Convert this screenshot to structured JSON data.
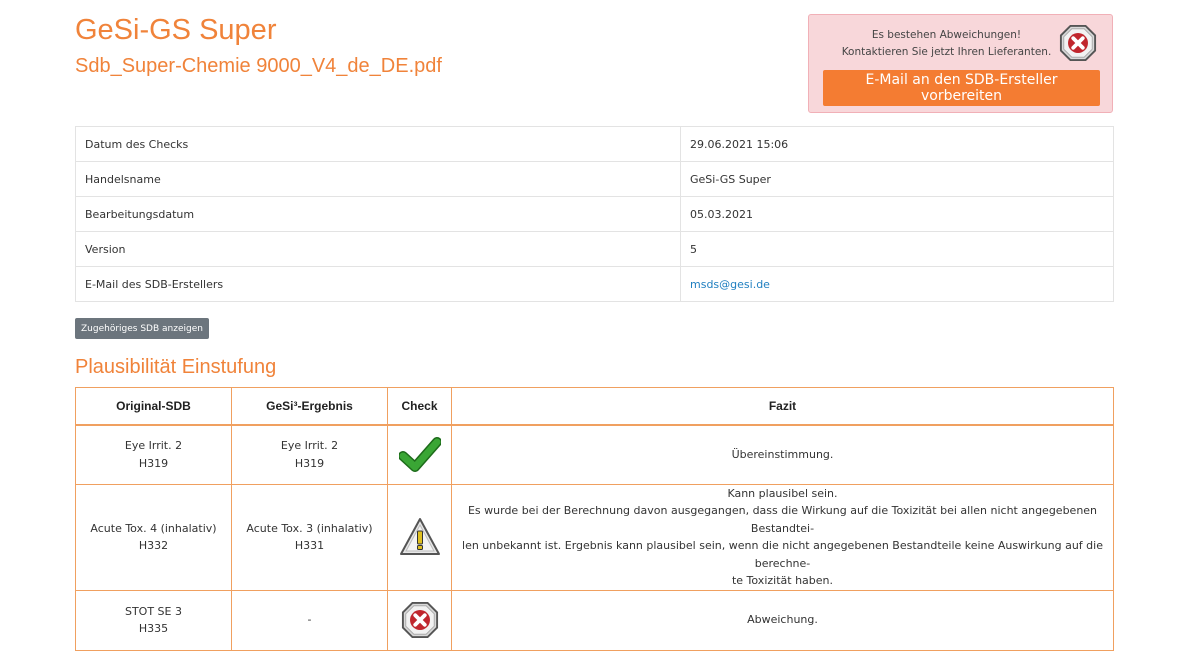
{
  "header": {
    "title": "GeSi-GS Super",
    "filename": "Sdb_Super-Chemie 9000_V4_de_DE.pdf"
  },
  "alert": {
    "line1": "Es bestehen Abweichungen!",
    "line2": "Kontaktieren Sie jetzt Ihren Lieferanten.",
    "button_label": "E-Mail an den SDB-Ersteller vorbereiten",
    "icon": "error-x-icon"
  },
  "info": {
    "rows": [
      {
        "label": "Datum des Checks",
        "value": "29.06.2021 15:06"
      },
      {
        "label": "Handelsname",
        "value": "GeSi-GS Super"
      },
      {
        "label": "Bearbeitungsdatum",
        "value": "05.03.2021"
      },
      {
        "label": "Version",
        "value": "5"
      },
      {
        "label": "E-Mail des SDB-Erstellers",
        "value": "msds@gesi.de"
      }
    ]
  },
  "sdb_button_label": "Zugehöriges SDB anzeigen",
  "plausibility": {
    "title": "Plausibilität Einstufung",
    "headers": {
      "original": "Original-SDB",
      "gesi": "GeSi³-Ergebnis",
      "check": "Check",
      "fazit": "Fazit"
    },
    "rows": [
      {
        "original": [
          "Eye Irrit. 2",
          "H319"
        ],
        "gesi": [
          "Eye Irrit. 2",
          "H319"
        ],
        "check_icon": "checkmark-icon",
        "fazit": [
          "Übereinstimmung."
        ]
      },
      {
        "original": [
          "Acute Tox. 4 (inhalativ)",
          "H332"
        ],
        "gesi": [
          "Acute Tox. 3 (inhalativ)",
          "H331"
        ],
        "check_icon": "warning-icon",
        "fazit": [
          "Kann plausibel sein.",
          "Es wurde bei der Berechnung davon ausgegangen, dass die Wirkung auf die Toxizität bei allen nicht angegebenen Bestandtei-",
          "len unbekannt ist. Ergebnis kann plausibel sein, wenn die nicht angegebenen Bestandteile keine Auswirkung auf die berechne-",
          "te Toxizität haben."
        ]
      },
      {
        "original": [
          "STOT SE 3",
          "H335"
        ],
        "gesi": [
          "-"
        ],
        "check_icon": "error-x-icon",
        "fazit": [
          "Abweichung."
        ]
      }
    ]
  },
  "colors": {
    "accent": "#f0833a",
    "alert_bg": "#f8d7da",
    "button_orange": "#f47c32",
    "button_gray": "#6c757d",
    "link": "#1f7fc0",
    "check_green": "#3aa635",
    "error_red": "#c0262d"
  }
}
